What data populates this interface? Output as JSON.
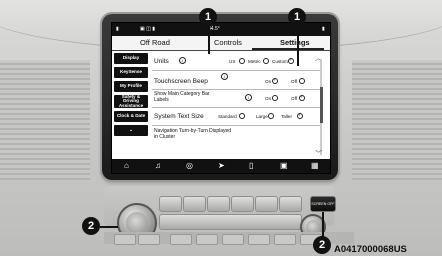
{
  "status_bar": {
    "center": "84.5°"
  },
  "tabs": [
    {
      "label": "Off Road",
      "active": false
    },
    {
      "label": "Controls",
      "active": false
    },
    {
      "label": "Settings",
      "active": true
    }
  ],
  "sidebar": [
    {
      "label": "Display"
    },
    {
      "label": "KeySense"
    },
    {
      "label": "My Profile"
    },
    {
      "label": "Safety & Driving Assistance"
    },
    {
      "label": "Clock & Date"
    }
  ],
  "settings": {
    "units": {
      "label": "Units",
      "options": [
        "US",
        "Metric",
        "Custom"
      ],
      "selected": "Custom"
    },
    "touch_beep": {
      "label": "Touchscreen Beep",
      "on": "On",
      "off": "Off",
      "selected": "On"
    },
    "main_cat_bar": {
      "label": "Show Main Category Bar Labels",
      "on": "On",
      "off": "Off",
      "selected": "Off"
    },
    "text_size": {
      "label": "System Text Size",
      "options": [
        "Standard",
        "Large",
        "Taller"
      ],
      "selected": "Taller"
    },
    "nav_cluster": {
      "label": "Navigation Turn-by-Turn Displayed in Cluster"
    }
  },
  "bottom_nav_icons": [
    "home-icon",
    "music-icon",
    "climate-icon",
    "navigation-icon",
    "phone-icon",
    "vehicle-icon",
    "apps-icon"
  ],
  "callouts": {
    "top_left": "1",
    "top_right": "1",
    "bottom_left": "2",
    "bottom_right": "2"
  },
  "panel": {
    "screen_off_label": "SCREEN OFF"
  },
  "figure_code": "A0417000068US"
}
